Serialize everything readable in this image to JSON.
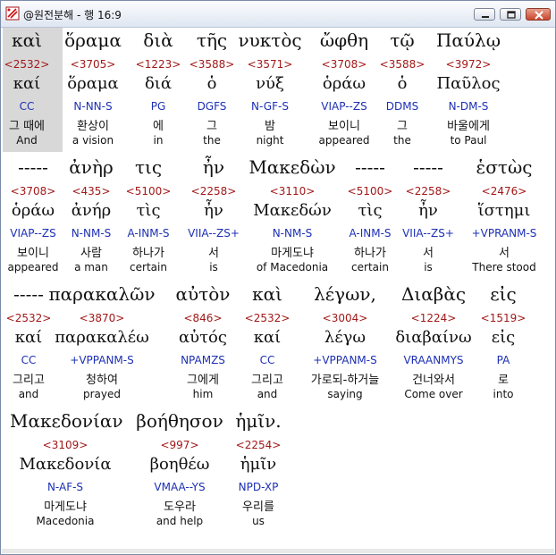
{
  "window": {
    "title": "@원전분해 - 행 16:9",
    "accent": "#1d30b4",
    "number_color": "#a21818"
  },
  "rows": [
    {
      "entries": [
        {
          "greek": "καὶ",
          "num": "<2532>",
          "lemma": "καί",
          "parse": "CC",
          "kor": "그 때에",
          "eng": "And"
        },
        {
          "greek": "ὅραμα",
          "num": "<3705>",
          "lemma": "ὅραμα",
          "parse": "N-NN-S",
          "kor": "환상이",
          "eng": "a vision"
        },
        {
          "greek": "διὰ",
          "num": "<1223>",
          "lemma": "διά",
          "parse": "PG",
          "kor": "에",
          "eng": "in"
        },
        {
          "greek": "τῆς",
          "num": "<3588>",
          "lemma": "ὁ",
          "parse": "DGFS",
          "kor": "그",
          "eng": "the"
        },
        {
          "greek": "νυκτὸς",
          "num": "<3571>",
          "lemma": "νύξ",
          "parse": "N-GF-S",
          "kor": "밤",
          "eng": "night"
        },
        {
          "greek": "ὤφθη",
          "num": "<3708>",
          "lemma": "ὁράω",
          "parse": "VIAP--ZS",
          "kor": "보이니",
          "eng": "appeared"
        },
        {
          "greek": "τῷ",
          "num": "<3588>",
          "lemma": "ὁ",
          "parse": "DDMS",
          "kor": "그",
          "eng": "the"
        },
        {
          "greek": "Παύλῳ",
          "num": "<3972>",
          "lemma": "Παῦλος",
          "parse": "N-DM-S",
          "kor": "바울에게",
          "eng": "to Paul"
        }
      ]
    },
    {
      "entries": [
        {
          "greek": "-----",
          "num": "<3708>",
          "lemma": "ὁράω",
          "parse": "VIAP--ZS",
          "kor": "보이니",
          "eng": "appeared"
        },
        {
          "greek": "ἀνὴρ",
          "num": "<435>",
          "lemma": "ἀνήρ",
          "parse": "N-NM-S",
          "kor": "사람",
          "eng": "a man"
        },
        {
          "greek": "τις",
          "num": "<5100>",
          "lemma": "τὶς",
          "parse": "A-INM-S",
          "kor": "하나가",
          "eng": "certain"
        },
        {
          "greek": "ἦν",
          "num": "<2258>",
          "lemma": "ἦν",
          "parse": "VIIA--ZS+",
          "kor": "서",
          "eng": "is"
        },
        {
          "greek": "Μακεδὼν",
          "num": "<3110>",
          "lemma": "Μακεδών",
          "parse": "N-NM-S",
          "kor": "마게도냐",
          "eng": "of Macedonia"
        },
        {
          "greek": "-----",
          "num": "<5100>",
          "lemma": "τὶς",
          "parse": "A-INM-S",
          "kor": "하나가",
          "eng": "certain"
        },
        {
          "greek": "-----",
          "num": "<2258>",
          "lemma": "ἦν",
          "parse": "VIIA--ZS+",
          "kor": "서",
          "eng": "is"
        },
        {
          "greek": "ἑστὼς",
          "num": "<2476>",
          "lemma": "ἵστημι",
          "parse": "+VPRANM-S",
          "kor": "서",
          "eng": "There stood"
        }
      ]
    },
    {
      "entries": [
        {
          "greek": "-----",
          "num": "<2532>",
          "lemma": "καί",
          "parse": "CC",
          "kor": "그리고",
          "eng": "and"
        },
        {
          "greek": "παρακαλῶν",
          "num": "<3870>",
          "lemma": "παρακαλέω",
          "parse": "+VPPANM-S",
          "kor": "청하여",
          "eng": "prayed"
        },
        {
          "greek": "αὐτὸν",
          "num": "<846>",
          "lemma": "αὐτός",
          "parse": "NPAMZS",
          "kor": "그에게",
          "eng": "him"
        },
        {
          "greek": "καὶ",
          "num": "<2532>",
          "lemma": "καί",
          "parse": "CC",
          "kor": "그리고",
          "eng": "and"
        },
        {
          "greek": "λέγων,",
          "num": "<3004>",
          "lemma": "λέγω",
          "parse": "+VPPANM-S",
          "kor": "가로되-하거늘",
          "eng": "saying"
        },
        {
          "greek": "Διαβὰς",
          "num": "<1224>",
          "lemma": "διαβαίνω",
          "parse": "VRAANMYS",
          "kor": "건너와서",
          "eng": "Come over"
        },
        {
          "greek": "εἰς",
          "num": "<1519>",
          "lemma": "εἰς",
          "parse": "PA",
          "kor": "로",
          "eng": "into"
        }
      ]
    },
    {
      "entries": [
        {
          "greek": "Μακεδονίαν",
          "num": "<3109>",
          "lemma": "Μακεδονία",
          "parse": "N-AF-S",
          "kor": "마게도냐",
          "eng": "Macedonia"
        },
        {
          "greek": "βοήθησον",
          "num": "<997>",
          "lemma": "βοηθέω",
          "parse": "VMAA--YS",
          "kor": "도우라",
          "eng": "and help"
        },
        {
          "greek": "ἡμῖν.",
          "num": "<2254>",
          "lemma": "ἡμῖν",
          "parse": "NPD-XP",
          "kor": "우리를",
          "eng": "us"
        }
      ]
    }
  ]
}
